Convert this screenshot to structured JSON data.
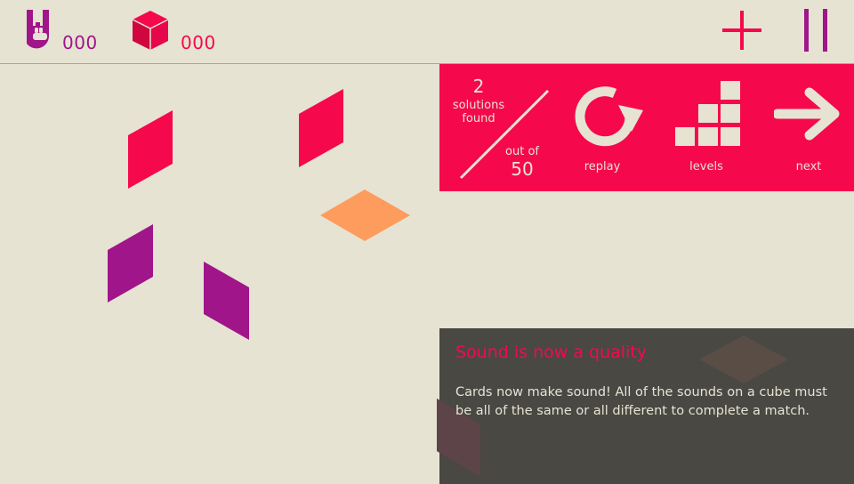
{
  "hud": {
    "rock_icon": "rock-hand-icon",
    "rock_count": "000",
    "cube_icon": "cube-icon",
    "cube_count": "000",
    "add_icon": "plus-icon",
    "pause_icon": "pause-icon"
  },
  "result": {
    "solutions_found": "2",
    "solutions_label": "solutions found",
    "out_of_label": "out of",
    "total": "50",
    "replay_label": "replay",
    "levels_label": "levels",
    "next_label": "next"
  },
  "tutorial": {
    "title": "Sound is now a quality",
    "body": "Cards now make sound! All of the sounds on a cube must be all of the same or all different to complete a match."
  },
  "colors": {
    "background": "#e6e3d3",
    "red": "#f5094c",
    "purple": "#a01589",
    "orange": "#fe9c5e",
    "panel_dark": "#494843"
  }
}
